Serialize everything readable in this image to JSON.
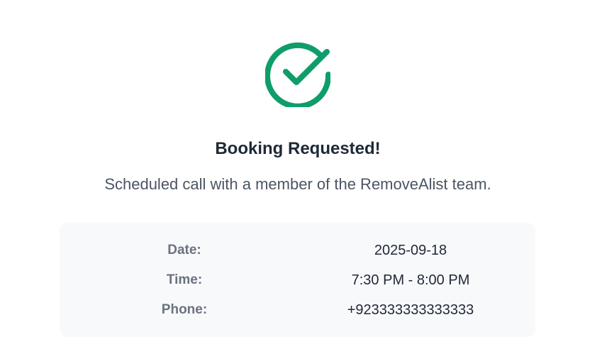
{
  "colors": {
    "accent": "#0f9d6a",
    "title": "#1f2937",
    "subtitle": "#4b5563",
    "label": "#6b7280",
    "panel_bg": "#f8f9fa"
  },
  "status_icon": "check-circle-icon",
  "title": "Booking Requested!",
  "subtitle": "Scheduled call with a member of the RemoveAlist team.",
  "details": [
    {
      "label": "Date:",
      "value": "2025-09-18"
    },
    {
      "label": "Time:",
      "value": "7:30 PM - 8:00 PM"
    },
    {
      "label": "Phone:",
      "value": "+923333333333333"
    }
  ]
}
